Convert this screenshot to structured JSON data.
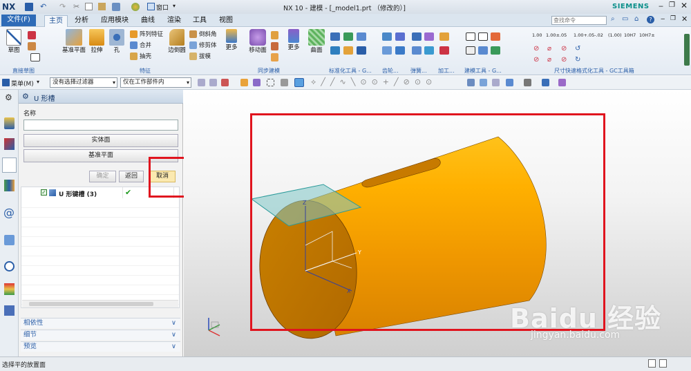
{
  "title": {
    "logo": "NX",
    "window_menu": "窗口",
    "caption": "NX 10 - 建模 - [_model1.prt （修改的）]",
    "brand": "SIEMENS"
  },
  "menu": {
    "file": "文件(F)",
    "tabs": [
      "主页",
      "分析",
      "应用模块",
      "曲线",
      "渲染",
      "工具",
      "视图"
    ],
    "search_placeholder": "查找命令"
  },
  "ribbon": {
    "sketch": "草图",
    "datum_plane": "基准平面",
    "extrude": "拉伸",
    "hole": "孔",
    "pattern_feature": "阵列特征",
    "unite": "合并",
    "shell": "抽壳",
    "edge_blend": "边倒圆",
    "chamfer": "倒斜角",
    "trim_body": "修剪体",
    "draft": "拔模",
    "more1": "更多",
    "move_face": "移动面",
    "more2": "更多",
    "surface": "曲面",
    "groups": [
      "直接草图",
      "特征",
      "同步建模",
      "标准化工具 - G...",
      "齿轮...",
      "弹簧...",
      "加工...",
      "建模工具 - G...",
      "尺寸快速格式化工具 - GC工具箱"
    ],
    "dim_formats": [
      "1.00",
      "1.00±.05",
      "1.00+.05-.02",
      "(1.00)",
      "10H7",
      "10H7±"
    ]
  },
  "toolbar2": {
    "menu": "菜单(M)",
    "filter": "没有选择过滤器",
    "scope": "仅在工作部件内"
  },
  "dialog": {
    "title": "U 形槽",
    "name_label": "名称",
    "name_value": "",
    "solid_face": "实体面",
    "datum_plane": "基准平面",
    "ok": "确定",
    "back": "返回",
    "cancel": "取消",
    "tree_item": "U 形键槽 (3)",
    "sections": [
      "相依性",
      "细节",
      "预览"
    ]
  },
  "status": {
    "prompt": "选择平的放置面"
  },
  "viewport": {
    "watermark_main": "Baidu 经验",
    "watermark_url": "jingyan.baidu.com",
    "axis_z": "Z",
    "axis_y": "Y",
    "axis_x": "X"
  },
  "colors": {
    "cylinder": "#f5a800",
    "cylinder_dark": "#b86d00",
    "highlight_box": "#e0141e",
    "datum_plane": "#7fc7c7"
  }
}
